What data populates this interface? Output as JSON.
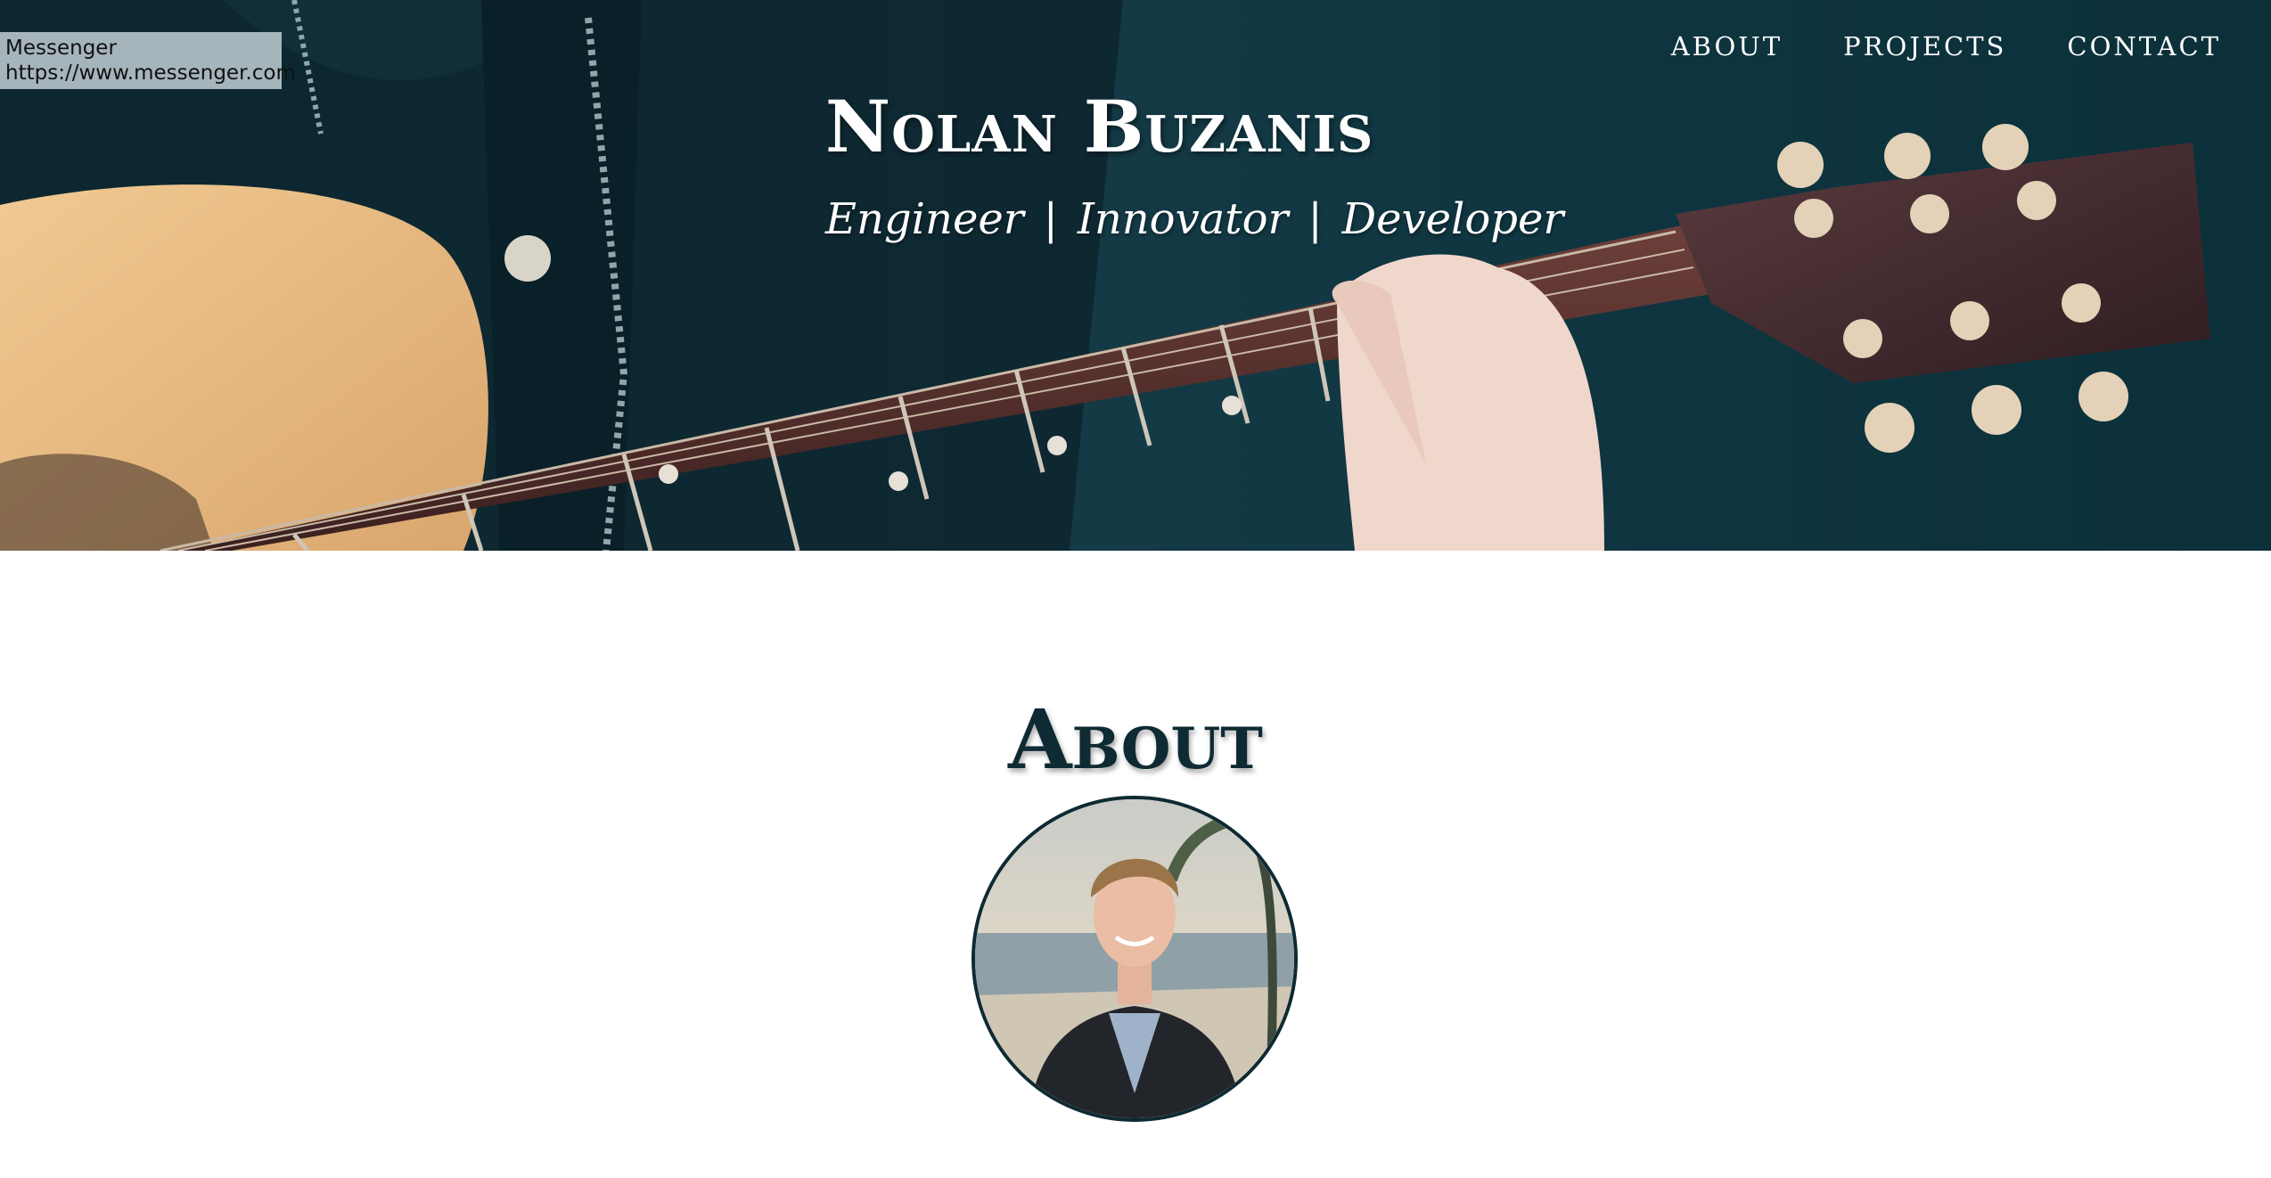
{
  "tooltip": {
    "title": "Messenger",
    "url": "https://www.messenger.com"
  },
  "nav": {
    "items": [
      "ABOUT",
      "PROJECTS",
      "CONTACT"
    ]
  },
  "hero": {
    "name": "Nolan Buzanis",
    "roles": [
      "Engineer",
      "Innovator",
      "Developer"
    ],
    "separator": "|",
    "image_icon": "guitar-photo"
  },
  "about": {
    "heading": "About",
    "avatar_icon": "profile-photo"
  },
  "colors": {
    "hero_bg": "#163c48",
    "heading": "#0e2a33",
    "white": "#ffffff"
  }
}
